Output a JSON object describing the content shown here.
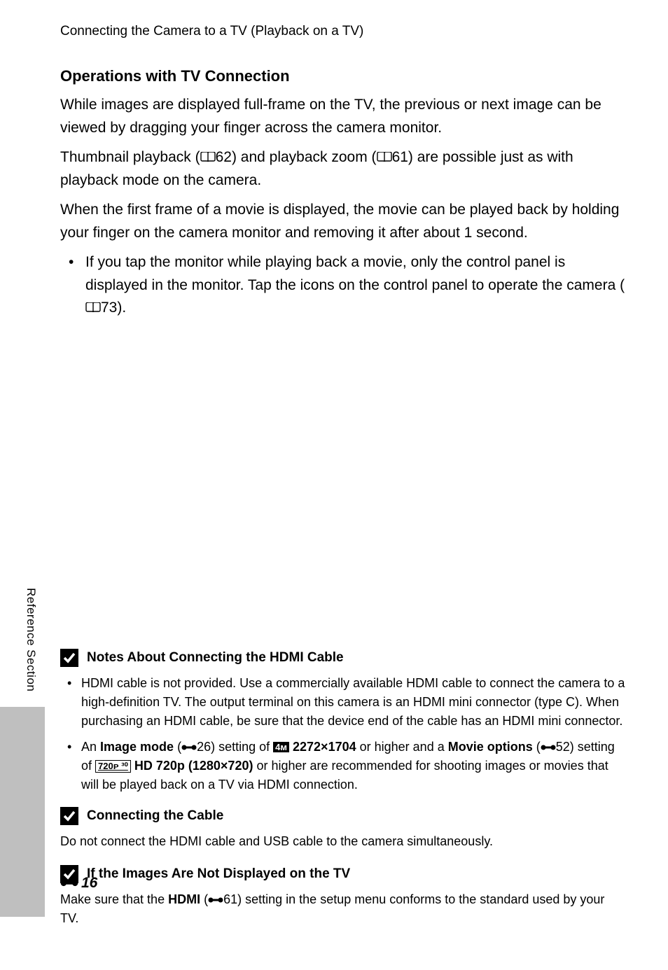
{
  "header": {
    "title": "Connecting the Camera to a TV (Playback on a TV)"
  },
  "section": {
    "heading": "Operations with TV Connection",
    "para1a": "While images are displayed full-frame on the TV, the previous or next image can be viewed by dragging your finger across the camera monitor.",
    "para2_pre": "Thumbnail playback (",
    "para2_ref1": "62",
    "para2_mid": ") and playback zoom (",
    "para2_ref2": "61",
    "para2_post": ") are possible just as with playback mode on the camera.",
    "para3": "When the first frame of a movie is displayed, the movie can be played back by holding your finger on the camera monitor and removing it after about 1 second.",
    "bullet_pre": "If you tap the monitor while playing back a movie, only the control panel is displayed in the monitor. Tap the icons on the control panel to operate the camera (",
    "bullet_ref": "73",
    "bullet_post": ")."
  },
  "notes": {
    "hdmi": {
      "heading": "Notes About Connecting the HDMI Cable",
      "b1": "HDMI cable is not provided. Use a commercially available HDMI cable to connect the camera to a high-definition TV. The output terminal on this camera is an HDMI mini connector (type C). When purchasing an HDMI cable, be sure that the device end of the cable has an HDMI mini connector.",
      "b2_pre": "An ",
      "b2_imagemode": "Image mode",
      "b2_ref1": "26",
      "b2_seg1": ") setting of ",
      "b2_badge1": "4ᴍ",
      "b2_res1": "2272×1704",
      "b2_seg2": " or higher and a ",
      "b2_movieopt": "Movie options",
      "b2_ref2": "52",
      "b2_seg3": ") setting of ",
      "b2_badge2": "720ᴘ ³⁰",
      "b2_hd": "HD 720p (1280×720)",
      "b2_tail": " or higher are recommended for shooting images or movies that will be played back on a TV via HDMI connection."
    },
    "cable": {
      "heading": "Connecting the Cable",
      "text": "Do not connect the HDMI cable and USB cable to the camera simultaneously."
    },
    "notdisplayed": {
      "heading": "If the Images Are Not Displayed on the TV",
      "pre": "Make sure that the ",
      "hdmi": "HDMI",
      "ref": "61",
      "post": ") setting in the setup menu conforms to the standard used by your TV."
    }
  },
  "side": {
    "label": "Reference Section"
  },
  "page_number": "16"
}
